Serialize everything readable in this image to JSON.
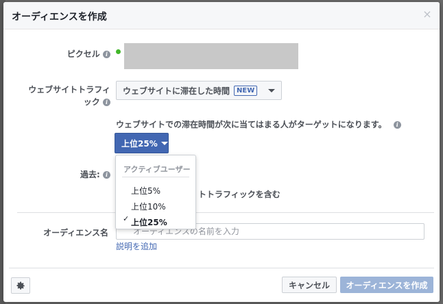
{
  "dialog": {
    "title": "オーディエンスを作成",
    "close_glyph": "×"
  },
  "pixel": {
    "label": "ピクセル"
  },
  "traffic": {
    "label_line1": "ウェブサイトトラフィ",
    "label_line2": "ック",
    "select_value": "ウェブサイトに滞在した時間",
    "badge": "NEW"
  },
  "helper_text": "ウェブサイトでの滞在時間が次に当てはまる人がターゲットになります。",
  "percentile": {
    "button_label": "上位25%",
    "menu_header": "アクティブユーザー",
    "options": [
      "上位5%",
      "上位10%",
      "上位25%"
    ],
    "selected_index": 2,
    "check_glyph": "✓"
  },
  "past": {
    "label": "過去:"
  },
  "include_text": "トトラフィックを含む",
  "audience_name": {
    "label": "オーディエンス名",
    "placeholder": "オーディエンスの名前を入力"
  },
  "add_description": "説明を追加",
  "footer": {
    "gear_icon": "gear-icon",
    "cancel_label": "キャンセル",
    "create_label": "オーディエンスを作成"
  },
  "colors": {
    "primary": "#4267b2",
    "disabled_primary": "#9cb4d8",
    "status_green": "#42b72a",
    "redacted_gray": "#c8c8c8"
  }
}
